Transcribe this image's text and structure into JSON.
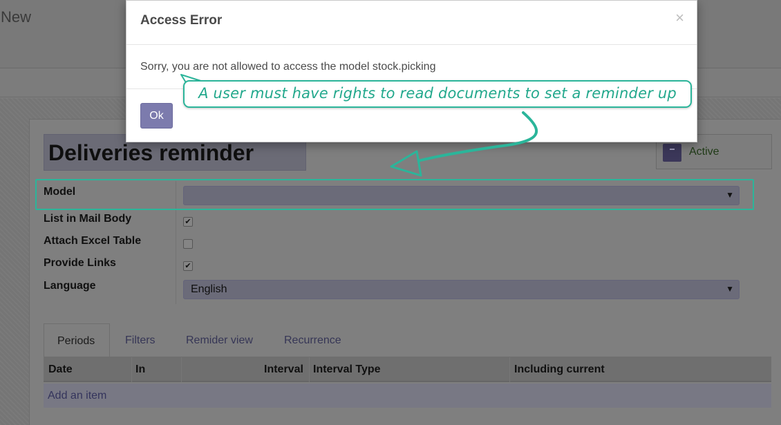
{
  "breadcrumb": {
    "title": "New"
  },
  "form": {
    "record_name": "Deliveries reminder",
    "active_label": "Active",
    "fields": {
      "model_label": "Model",
      "model_value": "",
      "list_in_mail_body_label": "List in Mail Body",
      "list_in_mail_body_checked": true,
      "attach_excel_table_label": "Attach Excel Table",
      "attach_excel_table_checked": false,
      "provide_links_label": "Provide Links",
      "provide_links_checked": true,
      "language_label": "Language",
      "language_value": "English"
    },
    "tabs": [
      {
        "label": "Periods",
        "active": true
      },
      {
        "label": "Filters",
        "active": false
      },
      {
        "label": "Remider view",
        "active": false
      },
      {
        "label": "Recurrence",
        "active": false
      }
    ],
    "grid": {
      "columns": [
        "Date",
        "In",
        "Interval",
        "Interval Type",
        "Including current"
      ],
      "add_item_label": "Add an item"
    }
  },
  "dialog": {
    "title": "Access Error",
    "close_symbol": "×",
    "message": "Sorry, you are not allowed to access the model stock.picking",
    "ok_label": "Ok"
  },
  "annotation": {
    "callout_text": "A user must have rights to read documents to set a reminder up",
    "accent_color": "#2bb59a"
  },
  "colors": {
    "primary_button": "#7c7bad",
    "dialog_title": "#4a4a4a",
    "active_text": "#1f3a16"
  }
}
